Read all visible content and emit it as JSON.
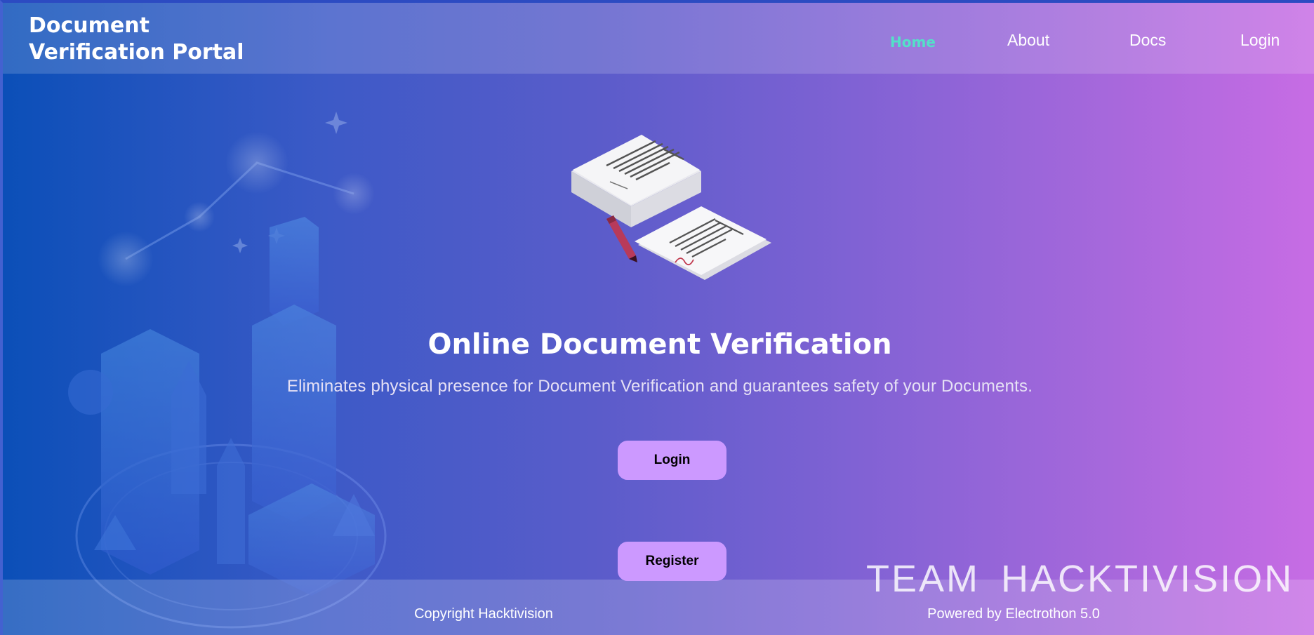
{
  "header": {
    "brand_line1": "Document",
    "brand_line2": "Verification Portal",
    "nav": [
      {
        "label": "Home",
        "active": true
      },
      {
        "label": "About",
        "active": false
      },
      {
        "label": "Docs",
        "active": false
      },
      {
        "label": "Login",
        "active": false
      }
    ]
  },
  "hero": {
    "title": "Online Document Verification",
    "subtitle": "Eliminates physical presence for Document Verification and guarantees safety of your Documents.",
    "illustration_icon": "documents-with-pen-icon"
  },
  "actions": {
    "login_label": "Login",
    "register_label": "Register"
  },
  "footer": {
    "copyright": "Copyright Hacktivision",
    "powered_by": "Powered by Electrothon 5.0",
    "team_mark": "TEAM HACKTIVISION"
  },
  "colors": {
    "gradient_start": "#0b4fb8",
    "gradient_end": "#c76ce4",
    "nav_active": "#54e0c8",
    "button_bg": "#cc99ff",
    "button_text": "#000000"
  }
}
